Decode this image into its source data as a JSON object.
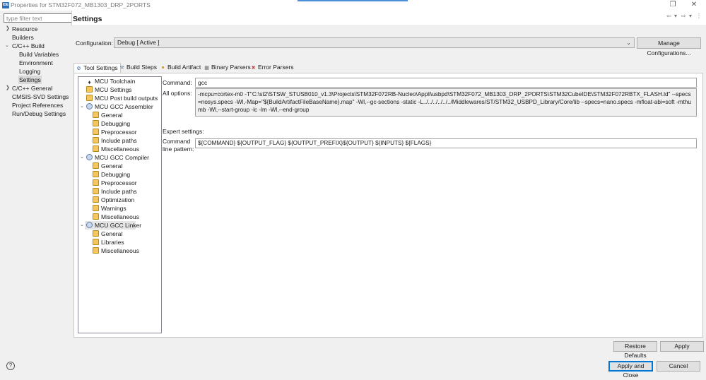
{
  "window": {
    "app_icon": "IDE",
    "title": "Properties for STM32F072_MB1303_DRP_2PORTS",
    "controls": {
      "restore": "❐",
      "close": "✕"
    }
  },
  "filter": {
    "placeholder": "type filter text"
  },
  "nav": {
    "items": [
      {
        "label": "Resource",
        "expandable": true
      },
      {
        "label": "Builders"
      },
      {
        "label": "C/C++ Build",
        "expanded": true
      },
      {
        "label": "Build Variables"
      },
      {
        "label": "Environment"
      },
      {
        "label": "Logging"
      },
      {
        "label": "Settings",
        "selected": true
      },
      {
        "label": "C/C++ General",
        "expandable": true
      },
      {
        "label": "CMSIS-SVD Settings"
      },
      {
        "label": "Project References"
      },
      {
        "label": "Run/Debug Settings"
      }
    ]
  },
  "page": {
    "title": "Settings"
  },
  "config": {
    "label": "Configuration:",
    "value": "Debug  [ Active ]",
    "manage_button": "Manage Configurations..."
  },
  "tabs": [
    {
      "label": "Tool Settings",
      "icon": "tool-settings-icon",
      "active": true
    },
    {
      "label": "Build Steps",
      "icon": "build-steps-icon"
    },
    {
      "label": "Build Artifact",
      "icon": "build-artifact-icon"
    },
    {
      "label": "Binary Parsers",
      "icon": "binary-parsers-icon"
    },
    {
      "label": "Error Parsers",
      "icon": "error-parsers-icon"
    }
  ],
  "tool_tree": [
    {
      "label": "MCU Toolchain",
      "level": 0,
      "icon": "tool"
    },
    {
      "label": "MCU Settings",
      "level": 0,
      "icon": "gear"
    },
    {
      "label": "MCU Post build outputs",
      "level": 0,
      "icon": "gear"
    },
    {
      "label": "MCU GCC Assembler",
      "level": 0,
      "icon": "disk",
      "expanded": true
    },
    {
      "label": "General",
      "level": 1,
      "icon": "gear"
    },
    {
      "label": "Debugging",
      "level": 1,
      "icon": "gear"
    },
    {
      "label": "Preprocessor",
      "level": 1,
      "icon": "gear"
    },
    {
      "label": "Include paths",
      "level": 1,
      "icon": "gear"
    },
    {
      "label": "Miscellaneous",
      "level": 1,
      "icon": "gear"
    },
    {
      "label": "MCU GCC Compiler",
      "level": 0,
      "icon": "disk",
      "expanded": true
    },
    {
      "label": "General",
      "level": 1,
      "icon": "gear"
    },
    {
      "label": "Debugging",
      "level": 1,
      "icon": "gear"
    },
    {
      "label": "Preprocessor",
      "level": 1,
      "icon": "gear"
    },
    {
      "label": "Include paths",
      "level": 1,
      "icon": "gear"
    },
    {
      "label": "Optimization",
      "level": 1,
      "icon": "gear"
    },
    {
      "label": "Warnings",
      "level": 1,
      "icon": "gear"
    },
    {
      "label": "Miscellaneous",
      "level": 1,
      "icon": "gear"
    },
    {
      "label": "MCU GCC Linker",
      "level": 0,
      "icon": "disk",
      "expanded": true,
      "selected": true
    },
    {
      "label": "General",
      "level": 1,
      "icon": "gear"
    },
    {
      "label": "Libraries",
      "level": 1,
      "icon": "gear"
    },
    {
      "label": "Miscellaneous",
      "level": 1,
      "icon": "gear"
    }
  ],
  "settings": {
    "command_label": "Command:",
    "command_value": "gcc",
    "all_options_label": "All options:",
    "all_options_value": "-mcpu=cortex-m0 -T\"C:\\st2\\STSW_STUSB010_v1.3\\Projects\\STM32F072RB-Nucleo\\Appli\\usbpd\\STM32F072_MB1303_DRP_2PORTS\\STM32CubeIDE\\STM32F072RBTX_FLASH.ld\" --specs=nosys.specs -Wl,-Map=\"${BuildArtifactFileBaseName}.map\" -Wl,--gc-sections -static -L../../../../../../Middlewares/ST/STM32_USBPD_Library/Core/lib --specs=nano.specs -mfloat-abi=soft -mthumb -Wl,--start-group -lc -lm -Wl,--end-group",
    "expert_label": "Expert settings:",
    "pattern_label_line1": "Command",
    "pattern_label_line2": "line pattern:",
    "pattern_value": "${COMMAND} ${OUTPUT_FLAG} ${OUTPUT_PREFIX}${OUTPUT} ${INPUTS} ${FLAGS}"
  },
  "buttons": {
    "restore_defaults": "Restore Defaults",
    "apply": "Apply",
    "apply_and_close": "Apply and Close",
    "cancel": "Cancel"
  }
}
